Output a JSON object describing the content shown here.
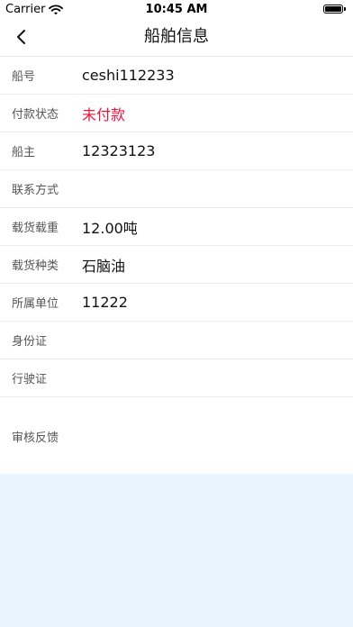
{
  "status_bar": {
    "carrier": "Carrier",
    "time": "10:45 AM"
  },
  "nav": {
    "title": "船舶信息"
  },
  "rows": [
    {
      "label": "船号",
      "value": "ceshi112233"
    },
    {
      "label": "付款状态",
      "value": "未付款",
      "value_color": "#e8163d"
    },
    {
      "label": "船主",
      "value": "12323123"
    },
    {
      "label": "联系方式",
      "value": ""
    },
    {
      "label": "载货载重",
      "value": "12.00吨"
    },
    {
      "label": "载货种类",
      "value": "石脑油"
    },
    {
      "label": "所属单位",
      "value": "11222"
    },
    {
      "label": "身份证",
      "value": ""
    },
    {
      "label": "行驶证",
      "value": ""
    }
  ],
  "feedback": {
    "label": "审核反馈"
  },
  "icons": {
    "back": "chevron-left-icon",
    "wifi": "wifi-icon",
    "battery": "battery-icon"
  },
  "colors": {
    "background": "#eaf4fd",
    "warning": "#e8163d"
  }
}
